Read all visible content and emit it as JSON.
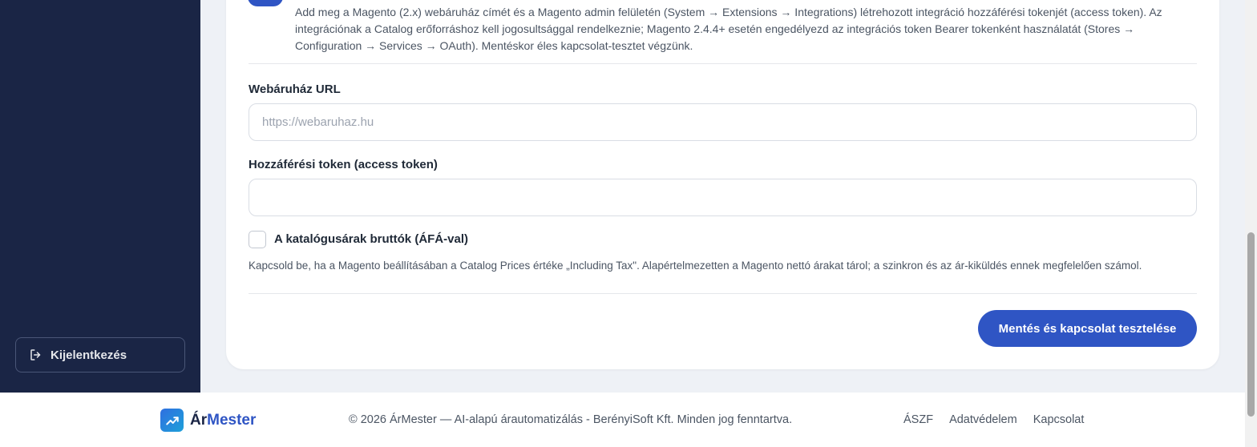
{
  "sidebar": {
    "logout_label": "Kijelentkezés",
    "logout_icon": "logout-icon"
  },
  "integration": {
    "info_text": "Add meg a Magento (2.x) webáruház címét és a Magento admin felületén (System → Extensions → Integrations) létrehozott integráció hozzáférési tokenjét (access token). Az integrációnak a Catalog erőforráshoz kell jogosultsággal rendelkeznie; Magento 2.4.4+ esetén engedélyezd az integrációs token Bearer tokenként használatát (Stores → Configuration → Services → OAuth). Mentéskor éles kapcsolat-tesztet végzünk.",
    "url_label": "Webáruház URL",
    "url_placeholder": "https://webaruhaz.hu",
    "url_value": "",
    "token_label": "Hozzáférési token (access token)",
    "token_value": "",
    "gross_checkbox_label": "A katalógusárak bruttók (ÁFÁ-val)",
    "gross_checked": false,
    "gross_help": "Kapcsold be, ha a Magento beállításában a Catalog Prices értéke „Including Tax\". Alapértelmezetten a Magento nettó árakat tárol; a szinkron és az ár-kiküldés ennek megfelelően számol.",
    "save_label": "Mentés és kapcsolat tesztelése"
  },
  "footer": {
    "brand_part1": "Ár",
    "brand_part2": "Mester",
    "copyright": "© 2026 ÁrMester — AI-alapú árautomatizálás - BerényiSoft Kft. Minden jog fenntartva.",
    "links": [
      "ÁSZF",
      "Adatvédelem",
      "Kapcsolat"
    ]
  },
  "colors": {
    "sidebar_bg": "#1a2545",
    "accent": "#2f55c4",
    "page_bg": "#eef1f6"
  }
}
